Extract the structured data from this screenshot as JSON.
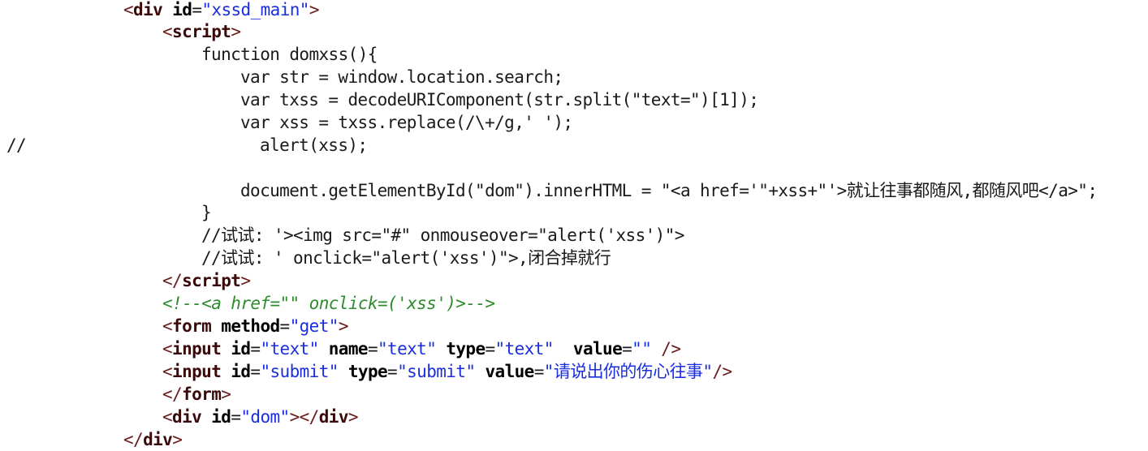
{
  "colors": {
    "background": "#ffffff",
    "text": "#1a1a1a",
    "tag_bracket": "#6a1b1b",
    "element": "#3a0a0a",
    "attribute": "#000000",
    "string": "#1a2ee0",
    "comment": "#2e8b2e"
  },
  "code": {
    "lines": [
      [
        {
          "t": "<",
          "k": "tag"
        },
        {
          "t": "div",
          "k": "el"
        },
        {
          "t": " ",
          "k": "text"
        },
        {
          "t": "id",
          "k": "attr"
        },
        {
          "t": "=",
          "k": "text"
        },
        {
          "t": "\"xssd_main\"",
          "k": "str"
        },
        {
          "t": ">",
          "k": "tag"
        }
      ],
      [
        {
          "t": "<",
          "k": "tag"
        },
        {
          "t": "script",
          "k": "el"
        },
        {
          "t": ">",
          "k": "tag"
        }
      ],
      [
        {
          "t": "function domxss(){",
          "k": "text"
        }
      ],
      [
        {
          "t": "var str = window.location.search;",
          "k": "text"
        }
      ],
      [
        {
          "t": "var txss = decodeURIComponent(str.split(\"text=\")[1]);",
          "k": "text"
        }
      ],
      [
        {
          "t": "var xss = txss.replace(/\\+/g,' ');",
          "k": "text"
        }
      ],
      [
        {
          "t": "//",
          "k": "text"
        }
      ],
      [
        {
          "t": "alert(xss);",
          "k": "text"
        }
      ],
      [
        {
          "t": "document.getElementById(\"dom\").innerHTML = \"<a href='\"+xss+\"'>就让往事都随风,都随风吧</a>\";",
          "k": "text"
        }
      ],
      [
        {
          "t": "}",
          "k": "text"
        }
      ],
      [
        {
          "t": "//试试: '><img src=\"#\" onmouseover=\"alert('xss')\">",
          "k": "text"
        }
      ],
      [
        {
          "t": "//试试: ' onclick=\"alert('xss')\">,闭合掉就行",
          "k": "text"
        }
      ],
      [
        {
          "t": "</",
          "k": "tag"
        },
        {
          "t": "script",
          "k": "el"
        },
        {
          "t": ">",
          "k": "tag"
        }
      ],
      [
        {
          "t": "<!--<a href=\"\" onclick=('xss')>-->",
          "k": "comment"
        }
      ],
      [
        {
          "t": "<",
          "k": "tag"
        },
        {
          "t": "form",
          "k": "el"
        },
        {
          "t": " ",
          "k": "text"
        },
        {
          "t": "method",
          "k": "attr"
        },
        {
          "t": "=",
          "k": "text"
        },
        {
          "t": "\"get\"",
          "k": "str"
        },
        {
          "t": ">",
          "k": "tag"
        }
      ],
      [
        {
          "t": "<",
          "k": "tag"
        },
        {
          "t": "input",
          "k": "el"
        },
        {
          "t": " ",
          "k": "text"
        },
        {
          "t": "id",
          "k": "attr"
        },
        {
          "t": "=",
          "k": "text"
        },
        {
          "t": "\"text\"",
          "k": "str"
        },
        {
          "t": " ",
          "k": "text"
        },
        {
          "t": "name",
          "k": "attr"
        },
        {
          "t": "=",
          "k": "text"
        },
        {
          "t": "\"text\"",
          "k": "str"
        },
        {
          "t": " ",
          "k": "text"
        },
        {
          "t": "type",
          "k": "attr"
        },
        {
          "t": "=",
          "k": "text"
        },
        {
          "t": "\"text\"",
          "k": "str"
        },
        {
          "t": "  ",
          "k": "text"
        },
        {
          "t": "value",
          "k": "attr"
        },
        {
          "t": "=",
          "k": "text"
        },
        {
          "t": "\"\"",
          "k": "str"
        },
        {
          "t": " />",
          "k": "tag"
        }
      ],
      [
        {
          "t": "<",
          "k": "tag"
        },
        {
          "t": "input",
          "k": "el"
        },
        {
          "t": " ",
          "k": "text"
        },
        {
          "t": "id",
          "k": "attr"
        },
        {
          "t": "=",
          "k": "text"
        },
        {
          "t": "\"submit\"",
          "k": "str"
        },
        {
          "t": " ",
          "k": "text"
        },
        {
          "t": "type",
          "k": "attr"
        },
        {
          "t": "=",
          "k": "text"
        },
        {
          "t": "\"submit\"",
          "k": "str"
        },
        {
          "t": " ",
          "k": "text"
        },
        {
          "t": "value",
          "k": "attr"
        },
        {
          "t": "=",
          "k": "text"
        },
        {
          "t": "\"请说出你的伤心往事\"",
          "k": "str"
        },
        {
          "t": "/>",
          "k": "tag"
        }
      ],
      [
        {
          "t": "</",
          "k": "tag"
        },
        {
          "t": "form",
          "k": "el"
        },
        {
          "t": ">",
          "k": "tag"
        }
      ],
      [
        {
          "t": "<",
          "k": "tag"
        },
        {
          "t": "div",
          "k": "el"
        },
        {
          "t": " ",
          "k": "text"
        },
        {
          "t": "id",
          "k": "attr"
        },
        {
          "t": "=",
          "k": "text"
        },
        {
          "t": "\"dom\"",
          "k": "str"
        },
        {
          "t": "></",
          "k": "tag"
        },
        {
          "t": "div",
          "k": "el"
        },
        {
          "t": ">",
          "k": "tag"
        }
      ],
      [
        {
          "t": "</",
          "k": "tag"
        },
        {
          "t": "div",
          "k": "el"
        },
        {
          "t": ">",
          "k": "tag"
        }
      ]
    ]
  }
}
